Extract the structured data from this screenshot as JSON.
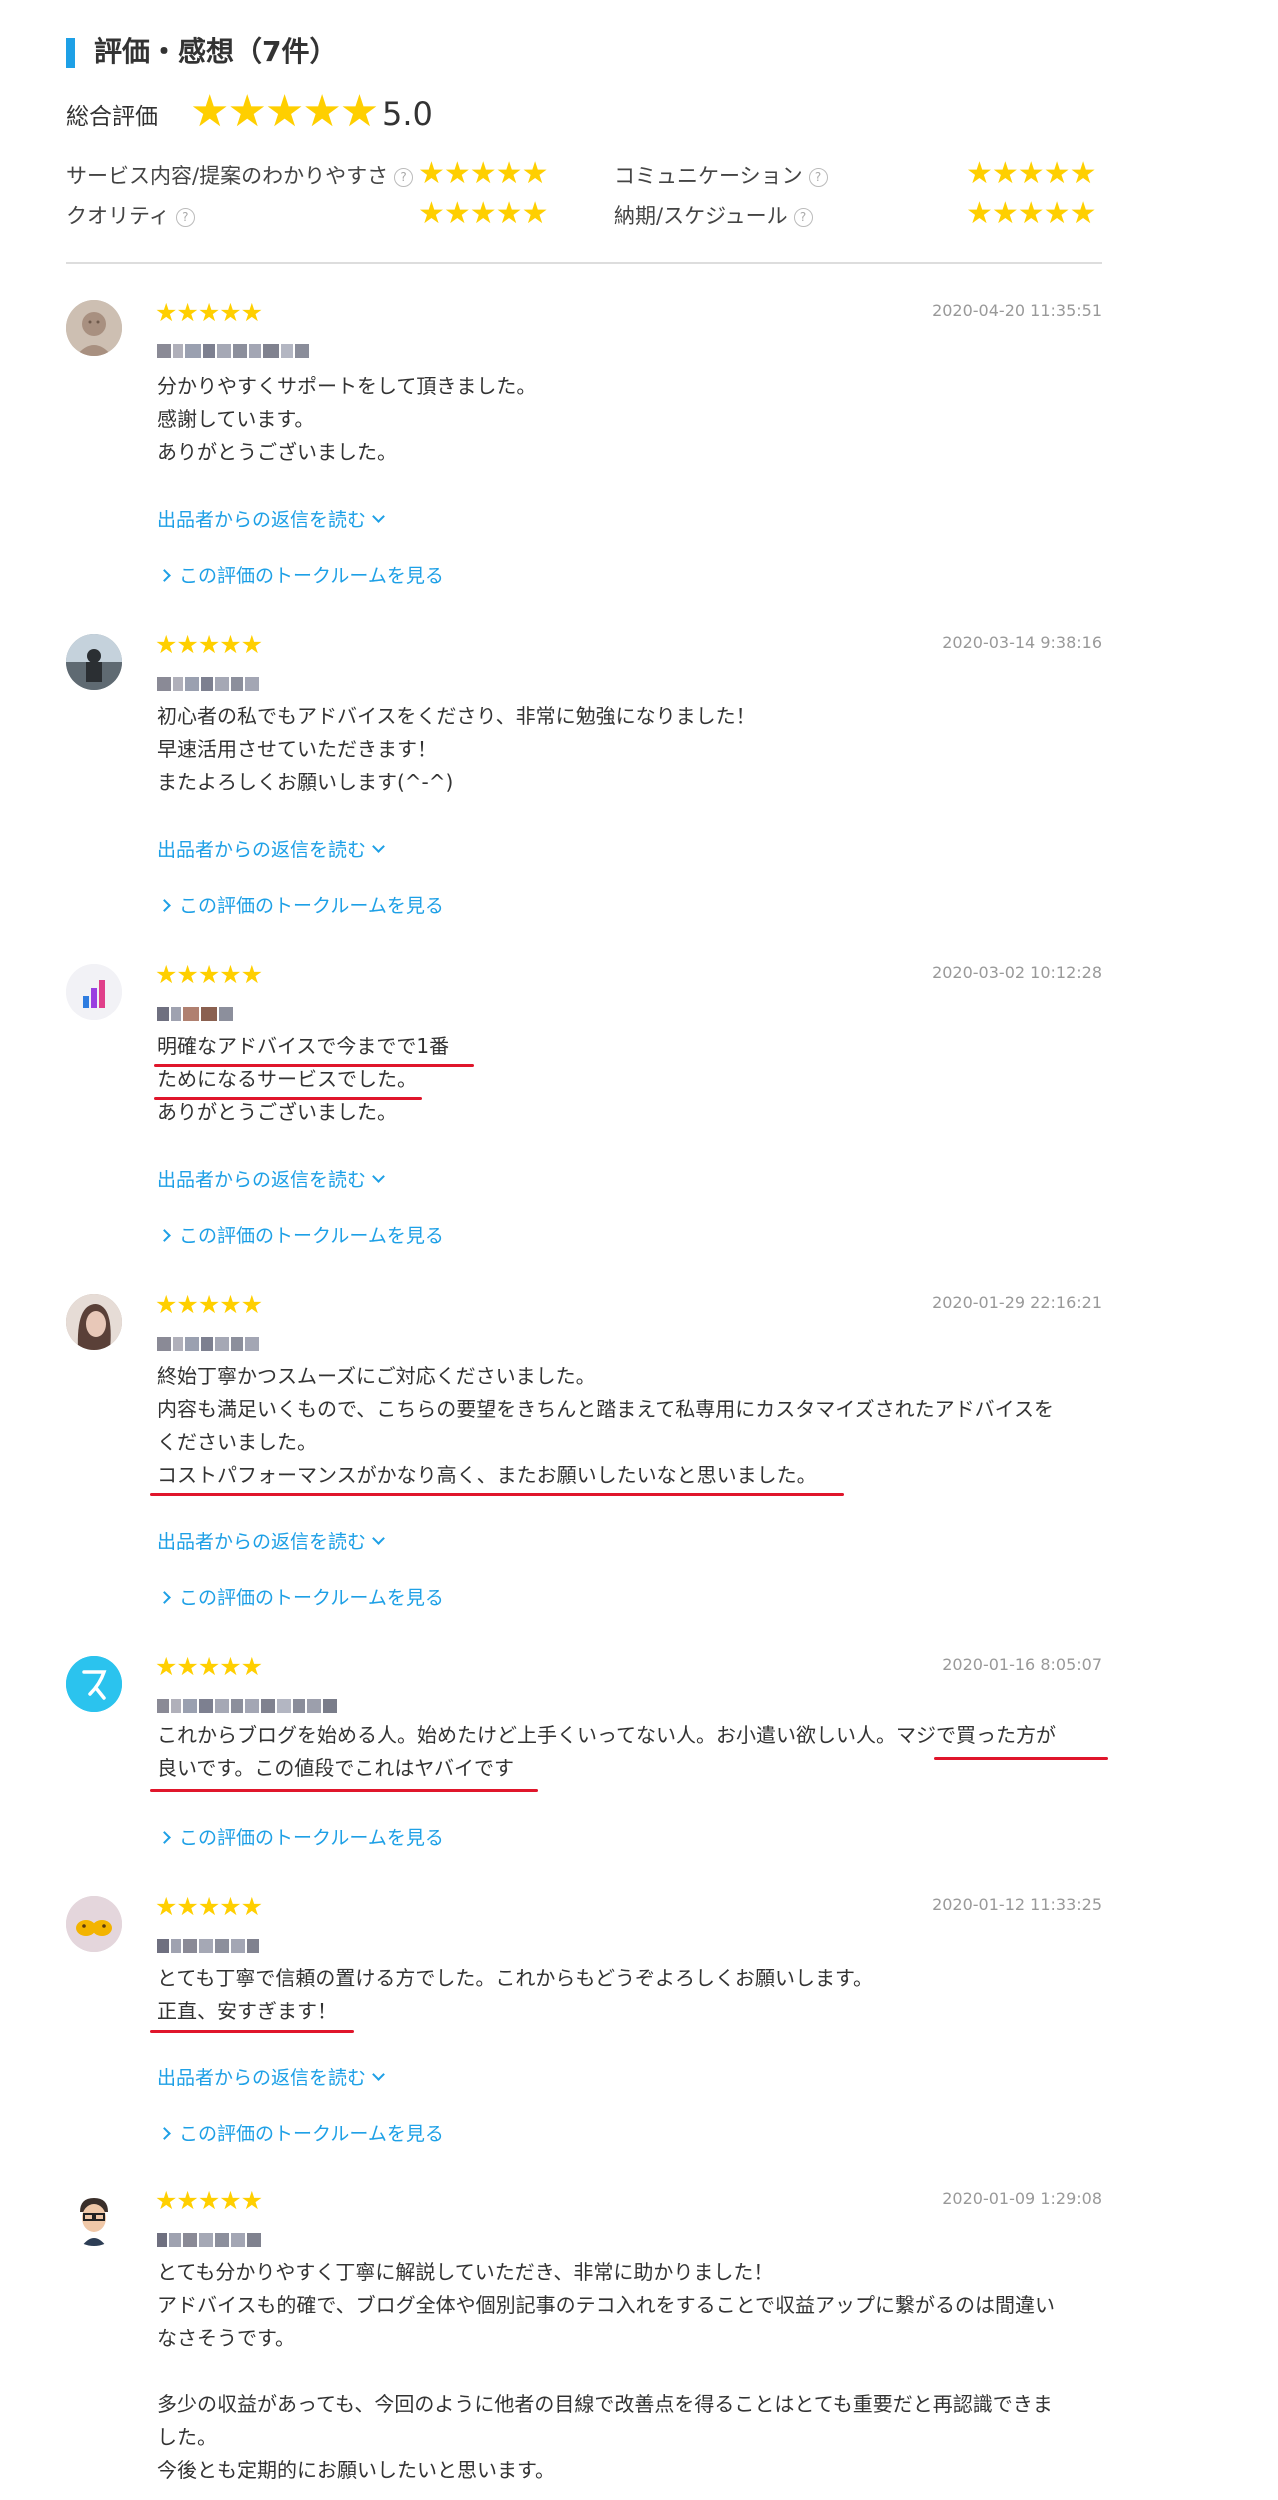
{
  "header": {
    "title": "評価・感想（7件）"
  },
  "overall": {
    "label": "総合評価",
    "stars": "★★★★★",
    "score": "5.0"
  },
  "criteria": [
    {
      "label": "サービス内容/提案のわかりやすさ",
      "stars": "★★★★★"
    },
    {
      "label": "コミュニケーション",
      "stars": "★★★★★"
    },
    {
      "label": "クオリティ",
      "stars": "★★★★★"
    },
    {
      "label": "納期/スケジュール",
      "stars": "★★★★★"
    }
  ],
  "colors": {
    "accent": "#1ea0e6",
    "star": "#ffcf00",
    "underline": "#e0162b"
  },
  "help_icon": "?",
  "reviews": [
    {
      "stars": "★★★★★",
      "date": "2020-04-20 11:35:51",
      "text": "分かりやすくサポートをして頂きました。\n感謝しています。\nありがとうございました。",
      "reply_link": "出品者からの返信を読む",
      "talk_link": "この評価のトークルームを見る"
    },
    {
      "stars": "★★★★★",
      "date": "2020-03-14 9:38:16",
      "text": "初心者の私でもアドバイスをくださり、非常に勉強になりました！\n早速活用させていただきます！\nまたよろしくお願いします(^-^)",
      "reply_link": "出品者からの返信を読む",
      "talk_link": "この評価のトークルームを見る"
    },
    {
      "stars": "★★★★★",
      "date": "2020-03-02 10:12:28",
      "text": "明確なアドバイスで今までで1番\nためになるサービスでした。\nありがとうございました。",
      "reply_link": "出品者からの返信を読む",
      "talk_link": "この評価のトークルームを見る"
    },
    {
      "stars": "★★★★★",
      "date": "2020-01-29 22:16:21",
      "text": "終始丁寧かつスムーズにご対応くださいました。\n内容も満足いくもので、こちらの要望をきちんと踏まえて私専用にカスタマイズされたアドバイスを\nくださいました。\nコストパフォーマンスがかなり高く、またお願いしたいなと思いました。",
      "reply_link": "出品者からの返信を読む",
      "talk_link": "この評価のトークルームを見る"
    },
    {
      "stars": "★★★★★",
      "date": "2020-01-16 8:05:07",
      "text": "これからブログを始める人。始めたけど上手くいってない人。お小遣い欲しい人。マジで買った方が\n良いです。この値段でこれはヤバイです",
      "talk_link": "この評価のトークルームを見る"
    },
    {
      "stars": "★★★★★",
      "date": "2020-01-12 11:33:25",
      "text": "とても丁寧で信頼の置ける方でした。これからもどうぞよろしくお願いします。\n正直、安すぎます！",
      "reply_link": "出品者からの返信を読む",
      "talk_link": "この評価のトークルームを見る"
    },
    {
      "stars": "★★★★★",
      "date": "2020-01-09 1:29:08",
      "text": "とても分かりやすく丁寧に解説していただき、非常に助かりました！\nアドバイスも的確で、ブログ全体や個別記事のテコ入れをすることで収益アップに繋がるのは間違い\nなさそうです。\n\n多少の収益があっても、今回のように他者の目線で改善点を得ることはとても重要だと再認識できま\nした。\n今後とも定期的にお願いしたいと思います。"
    }
  ]
}
